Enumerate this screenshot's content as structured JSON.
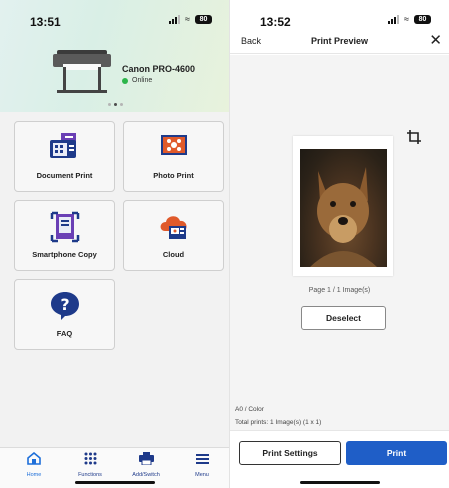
{
  "left": {
    "status": {
      "time": "13:51",
      "battery": "80"
    },
    "printer": {
      "name": "Canon PRO-4600",
      "status": "Online",
      "status_color": "#2cb54a"
    },
    "tiles": [
      {
        "label": "Document Print",
        "icon": "document-print-icon"
      },
      {
        "label": "Photo Print",
        "icon": "photo-print-icon"
      },
      {
        "label": "Smartphone Copy",
        "icon": "smartphone-copy-icon"
      },
      {
        "label": "Cloud",
        "icon": "cloud-icon"
      },
      {
        "label": "FAQ",
        "icon": "faq-icon"
      }
    ],
    "tabbar": [
      {
        "label": "Home",
        "icon": "home-icon"
      },
      {
        "label": "Functions",
        "icon": "grid-icon"
      },
      {
        "label": "Add/Switch",
        "icon": "printer-icon"
      },
      {
        "label": "Menu",
        "icon": "menu-icon"
      }
    ]
  },
  "right": {
    "status": {
      "time": "13:52",
      "battery": "80"
    },
    "nav": {
      "back": "Back",
      "title": "Print Preview",
      "close": "✕"
    },
    "preview": {
      "page_info": "Page 1 / 1 Image(s)",
      "deselect": "Deselect"
    },
    "meta": {
      "paper": "A0 / Color",
      "total": "Total prints: 1 Image(s) (1 x 1)"
    },
    "footer": {
      "settings": "Print Settings",
      "print": "Print"
    }
  },
  "colors": {
    "accent": "#1f5ec7",
    "icon_navy": "#1e3a8a",
    "icon_purple": "#6a3fb5",
    "icon_orange": "#e05a2b"
  }
}
